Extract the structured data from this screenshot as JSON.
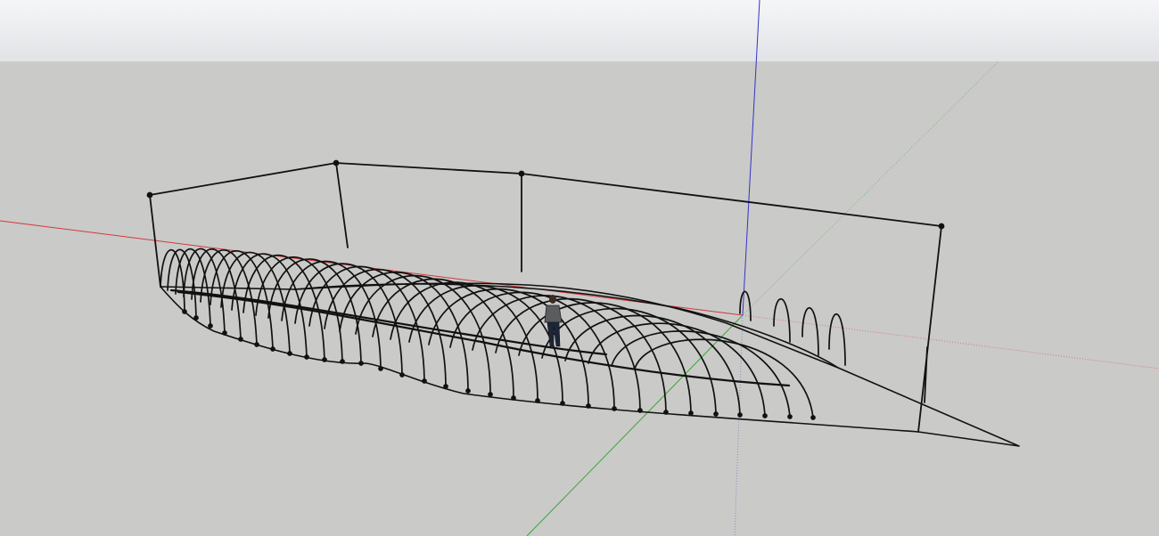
{
  "app": {
    "type": "3d-modeling-viewport"
  },
  "scene": {
    "sky_color_top": "#f4f5f7",
    "sky_color_bottom": "#e3e5e8",
    "ground_color": "#cacac8",
    "axis_colors": {
      "red": "#d23a3a",
      "green": "#3aa83a",
      "blue": "#3434c8"
    },
    "model_line_color": "#111111",
    "objects": [
      {
        "name": "boat-hull-wireframe"
      },
      {
        "name": "person-scale-figure"
      },
      {
        "name": "support-frame"
      }
    ]
  }
}
